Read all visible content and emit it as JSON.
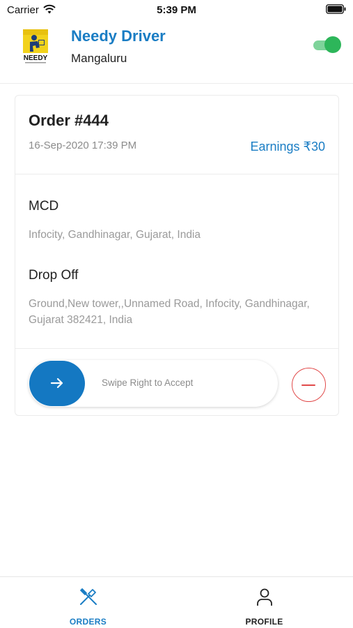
{
  "status_bar": {
    "carrier": "Carrier",
    "time": "5:39 PM"
  },
  "header": {
    "logo_text": "NEEDY",
    "title": "Needy Driver",
    "city": "Mangaluru",
    "online_toggle": true
  },
  "order": {
    "title": "Order #444",
    "date": "16-Sep-2020 17:39 PM",
    "earnings": "Earnings ₹30",
    "pickup_name": "MCD",
    "pickup_address": "Infocity, Gandhinagar, Gujarat, India",
    "drop_label": "Drop Off",
    "drop_address": "Ground,New tower,,Unnamed Road, Infocity, Gandhinagar, Gujarat 382421, India",
    "swipe_text": "Swipe Right to Accept"
  },
  "tabs": [
    {
      "label": "ORDERS",
      "icon": "fork-knife-icon",
      "active": true
    },
    {
      "label": "PROFILE",
      "icon": "person-icon",
      "active": false
    }
  ],
  "colors": {
    "accent": "#1a7dc4",
    "swipe_button": "#1478c2",
    "toggle_on": "#2db65a",
    "reject": "#e14a4a"
  }
}
